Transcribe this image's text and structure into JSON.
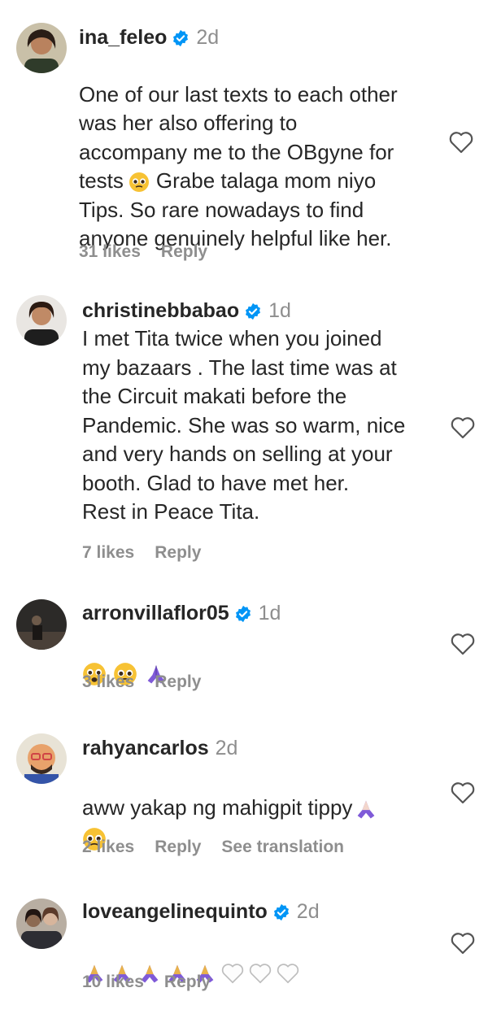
{
  "comments": [
    {
      "username": "ina_feleo",
      "verified": true,
      "time": "2d",
      "text": "One of our last texts to each other\nwas her also offering to\naccompany me to the OBgyne for\ntests",
      "text_after": "Grabe talaga mom niyo\nTips. So rare nowadays to find\nanyone genuinely helpful like her.",
      "likes": "31 likes",
      "reply": "Reply"
    },
    {
      "username": "christinebbabao",
      "verified": true,
      "time": "1d",
      "text": "I met Tita twice when you joined\nmy bazaars . The last time was at\nthe Circuit makati before the\nPandemic. She was so warm, nice\nand very hands on selling at your\nbooth. Glad to have met her.\nRest in Peace Tita.",
      "likes": "7 likes",
      "reply": "Reply"
    },
    {
      "username": "arronvillaflor05",
      "verified": true,
      "time": "1d",
      "emojis": [
        "crying-face-emoji",
        "pleading-face-emoji",
        "folded-hands-emoji"
      ],
      "likes": "3 likes",
      "reply": "Reply"
    },
    {
      "username": "rahyancarlos",
      "verified": false,
      "time": "2d",
      "text": "aww yakap ng mahigpit tippy",
      "likes": "2 likes",
      "reply": "Reply",
      "see_translation": "See translation"
    },
    {
      "username": "loveangelinequinto",
      "verified": true,
      "time": "2d",
      "emojis": [
        "folded-hands-emoji",
        "folded-hands-emoji",
        "folded-hands-emoji",
        "folded-hands-emoji",
        "folded-hands-emoji",
        "white-heart-emoji",
        "white-heart-emoji",
        "white-heart-emoji"
      ],
      "likes": "10 likes",
      "reply": "Reply"
    }
  ],
  "colors": {
    "text": "#262626",
    "secondary": "#8e8e8e",
    "verified_blue": "#0095f6",
    "emoji_yellow": "#f7c234",
    "folded_hands_purple": "#7f5ad8"
  }
}
